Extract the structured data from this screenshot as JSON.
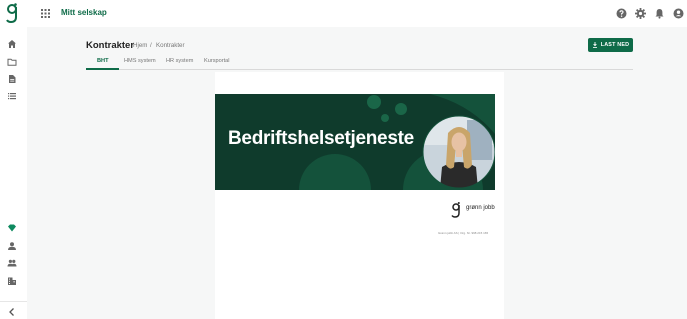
{
  "topbar": {
    "company": "Mitt selskap",
    "icons": [
      "help-icon",
      "settings-icon",
      "notifications-icon",
      "account-icon"
    ]
  },
  "sidebar": {
    "icons": [
      "home-icon",
      "folder-icon",
      "document-icon",
      "list-icon",
      "diamond-icon",
      "person-icon",
      "people-icon",
      "business-icon",
      "chevron-left-icon"
    ]
  },
  "page": {
    "title": "Kontrakter",
    "breadcrumb": [
      "Hjem",
      "/",
      "Kontrakter"
    ],
    "download_label": "LAST NED"
  },
  "tabs": [
    {
      "label": "BHT",
      "active": true
    },
    {
      "label": "HMS system",
      "active": false
    },
    {
      "label": "HR system",
      "active": false
    },
    {
      "label": "Kursportal",
      "active": false
    }
  ],
  "document": {
    "banner_title": "Bedriftshelsetjeneste",
    "brand": "grønn jobb",
    "footer": "Grønn jobb AS | Org. Nr. 998 215 165"
  },
  "colors": {
    "primary": "#0e6b48",
    "banner_dark": "#0f3b2c",
    "banner_mid": "#14523b"
  }
}
